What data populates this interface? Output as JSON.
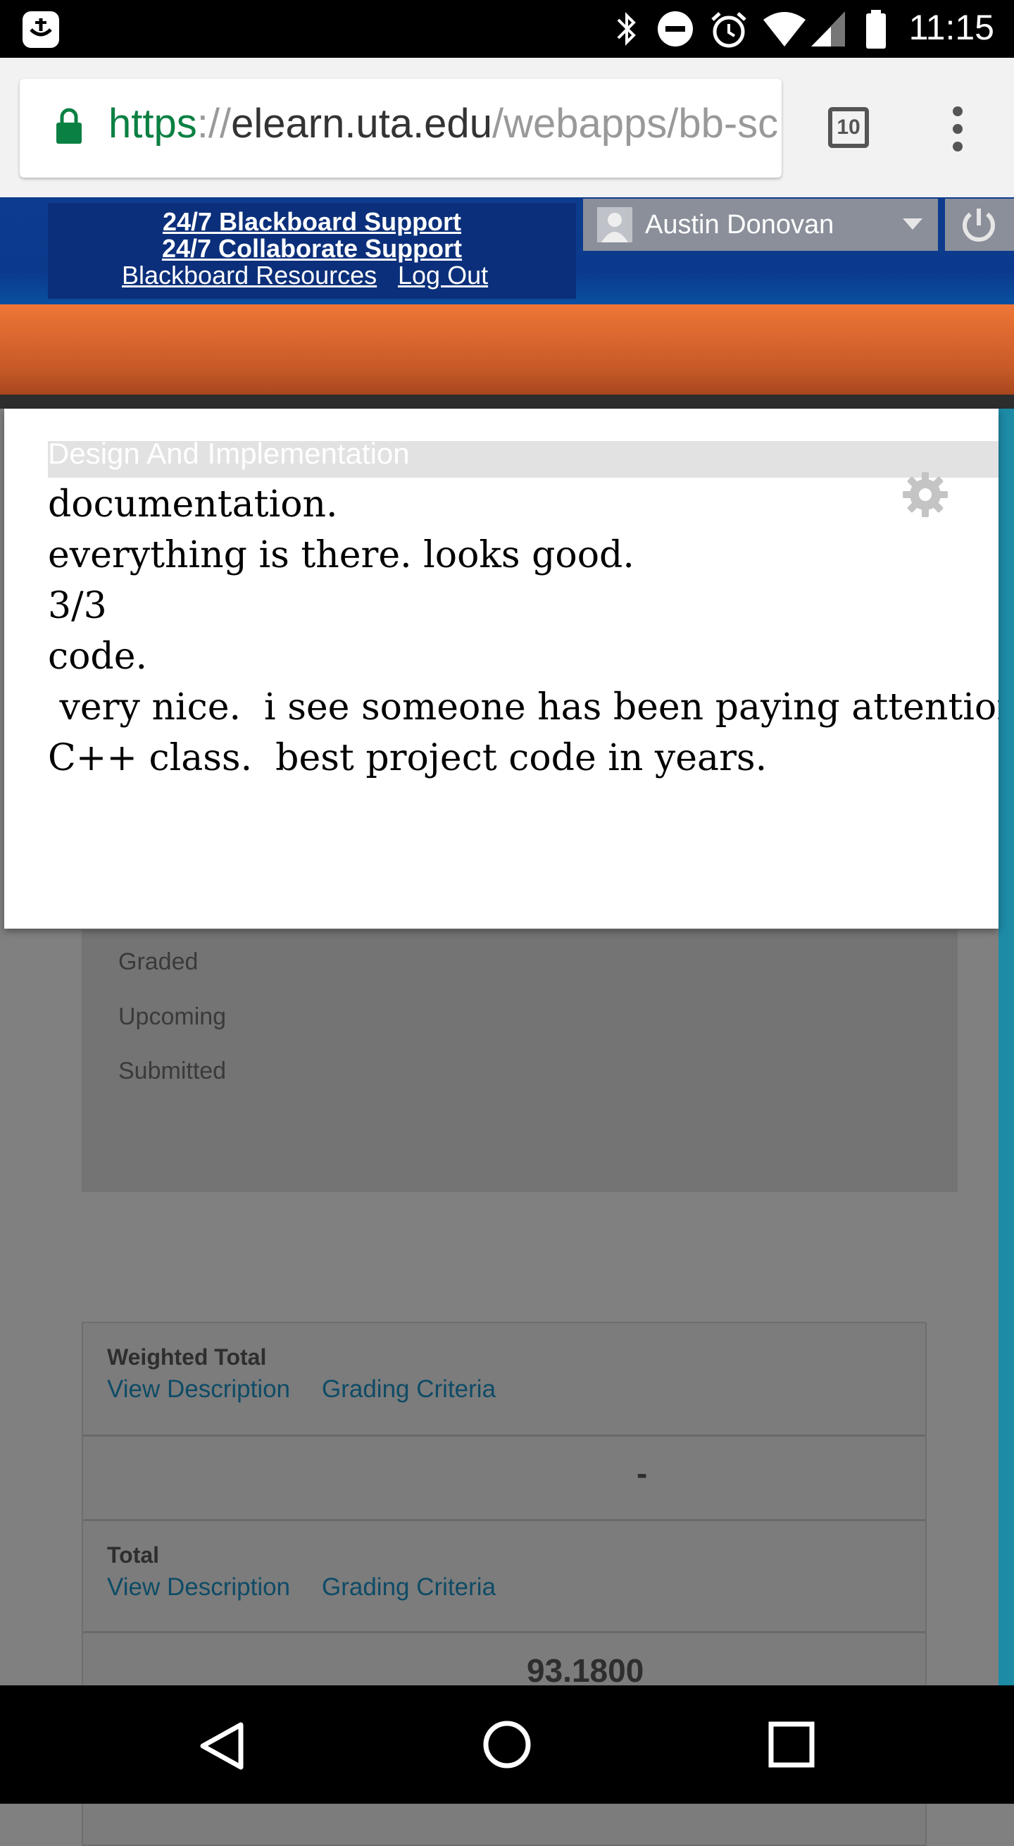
{
  "status_bar": {
    "time": "11:15",
    "icons": [
      "notification-icon",
      "bluetooth-icon",
      "do-not-disturb-icon",
      "alarm-icon",
      "wifi-icon",
      "signal-icon",
      "battery-icon"
    ]
  },
  "browser": {
    "url_scheme": "https",
    "url_sep": "://",
    "url_host": "elearn.uta.edu",
    "url_path": "/webapps/bb-sc",
    "tab_count": "10"
  },
  "header": {
    "support_link_1": "24/7 Blackboard Support",
    "support_link_2": "24/7 Collaborate Support",
    "resources_link": "Blackboard Resources",
    "logout_link": "Log Out",
    "user_name": "Austin Donovan"
  },
  "modal": {
    "ghost_heading": "Design And Implementation",
    "feedback_lines": [
      "documentation.",
      "everything is there. looks good.",
      "3/3",
      "code.",
      " very nice.  i see someone has been paying attention in",
      "C++ class.  best project code in years."
    ]
  },
  "filters": [
    "Graded",
    "Upcoming",
    "Submitted"
  ],
  "grades_table": {
    "rows": [
      {
        "title": "Weighted Total",
        "link1": "View Description",
        "link2": "Grading Criteria",
        "value": "-"
      },
      {
        "title": "Total",
        "link1": "View Description",
        "link2": "Grading Criteria",
        "value": "93.1800"
      }
    ]
  },
  "colors": {
    "header_blue": "#0d3c8f",
    "orange": "#ee7637",
    "teal": "#1d8aa6",
    "link_dark_teal": "#0e4b66"
  }
}
